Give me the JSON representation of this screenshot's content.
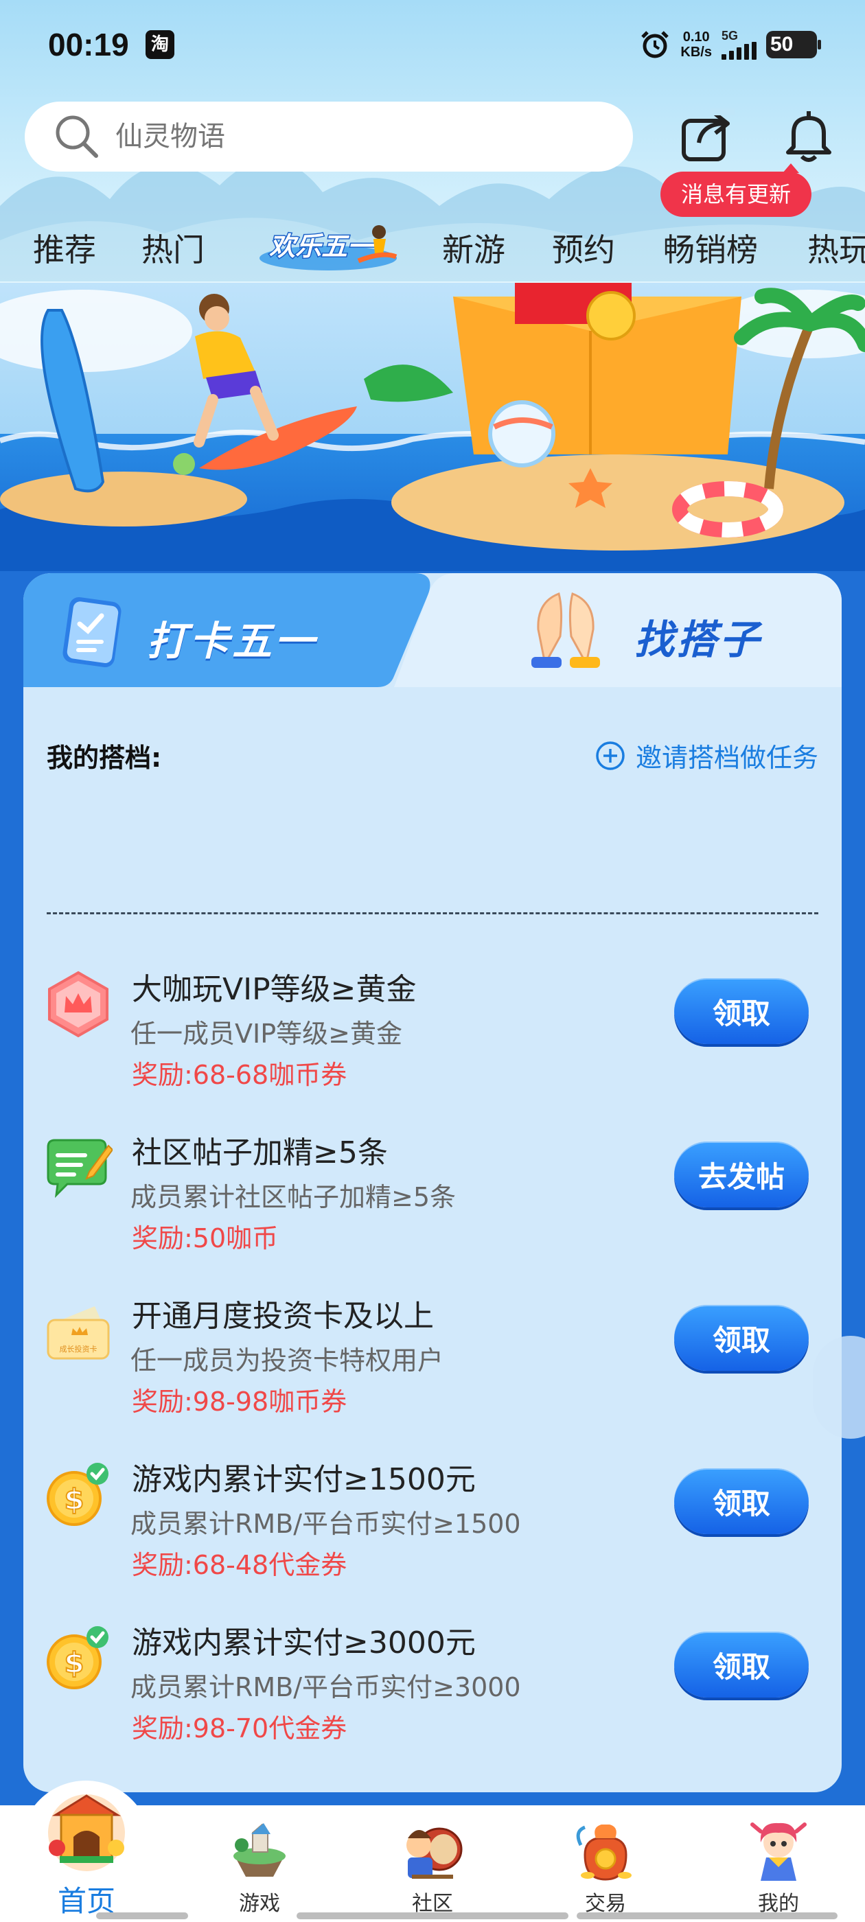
{
  "status_bar": {
    "time": "00:19",
    "app_icon_text": "淘",
    "net_speed_value": "0.10",
    "net_speed_unit": "KB/s",
    "network": "5G",
    "battery": "50"
  },
  "search": {
    "placeholder": "仙灵物语"
  },
  "header": {
    "message_badge": "消息有更新"
  },
  "top_tabs": [
    {
      "label": "推荐"
    },
    {
      "label": "热门"
    },
    {
      "label": "欢乐五一",
      "is_image": true
    },
    {
      "label": "新游"
    },
    {
      "label": "预约"
    },
    {
      "label": "畅销榜"
    },
    {
      "label": "热玩"
    }
  ],
  "card": {
    "tabs": [
      {
        "label": "打卡五一",
        "active": true
      },
      {
        "label": "找搭子",
        "active": false
      }
    ],
    "partner_title": "我的搭档:",
    "invite_label": "邀请搭档做任务",
    "tasks": [
      {
        "title": "大咖玩VIP等级≥黄金",
        "desc": "任一成员VIP等级≥黄金",
        "reward": "奖励:68-68咖币券",
        "button": "领取",
        "icon": "vip-crown-icon"
      },
      {
        "title": "社区帖子加精≥5条",
        "desc": "成员累计社区帖子加精≥5条",
        "reward": "奖励:50咖币",
        "button": "去发帖",
        "icon": "post-edit-icon"
      },
      {
        "title": "开通月度投资卡及以上",
        "desc": "任一成员为投资卡特权用户",
        "reward": "奖励:98-98咖币券",
        "button": "领取",
        "icon": "investment-card-icon",
        "card_icon_text": "成长投资卡"
      },
      {
        "title": "游戏内累计实付≥1500元",
        "desc": "成员累计RMB/平台币实付≥1500",
        "reward": "奖励:68-48代金券",
        "button": "领取",
        "icon": "coin-check-icon"
      },
      {
        "title": "游戏内累计实付≥3000元",
        "desc": "成员累计RMB/平台币实付≥3000",
        "reward": "奖励:98-70代金券",
        "button": "领取",
        "icon": "coin-check-icon"
      }
    ]
  },
  "bottom_nav": [
    {
      "label": "首页",
      "active": true,
      "icon": "home-gate-icon"
    },
    {
      "label": "游戏",
      "active": false,
      "icon": "game-island-icon"
    },
    {
      "label": "社区",
      "active": false,
      "icon": "community-drum-icon"
    },
    {
      "label": "交易",
      "active": false,
      "icon": "trade-bag-icon"
    },
    {
      "label": "我的",
      "active": false,
      "icon": "profile-character-icon"
    }
  ],
  "colors": {
    "accent_blue": "#1a7de0",
    "button_blue": "#1562e6",
    "reward_red": "#f04848",
    "badge_red": "#f0344a",
    "card_bg": "#d2e9fb",
    "page_bg": "#1f6fd6"
  }
}
